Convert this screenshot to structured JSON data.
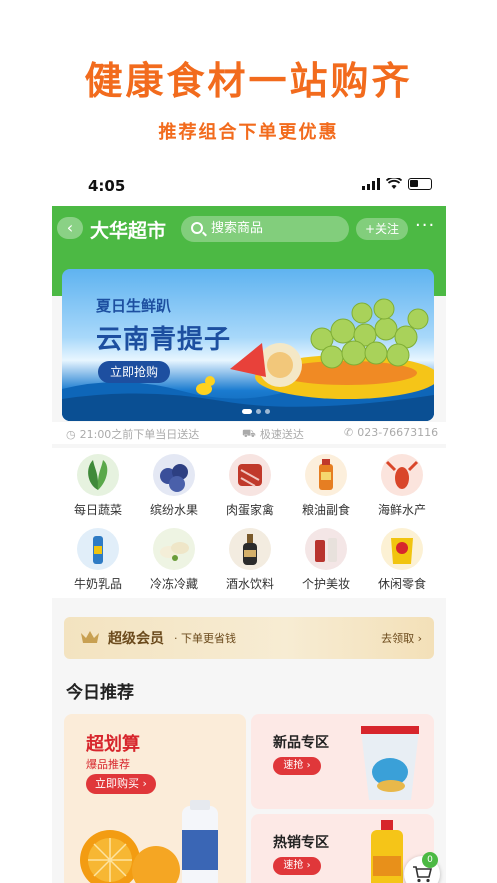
{
  "promo": {
    "headline": "健康食材一站购齐",
    "subline": "推荐组合下单更优惠"
  },
  "status_bar": {
    "time": "4:05"
  },
  "header": {
    "back_icon": "chevron-left-icon",
    "store_name": "大华超市",
    "search_placeholder": "搜索商品",
    "follow_label": "+关注",
    "more_label": "···",
    "accent_color": "#4cb944"
  },
  "banner": {
    "kicker": "夏日生鲜趴",
    "title": "云南青提子",
    "button_label": "立即抢购"
  },
  "info_strip": {
    "hours": "21:00之前下单当日送达",
    "delivery": "极速送达",
    "phone": "023-76673116"
  },
  "categories": [
    {
      "label": "每日蔬菜",
      "icon": "vegetable-icon",
      "color": "#3f8a3a"
    },
    {
      "label": "缤纷水果",
      "icon": "blueberry-icon",
      "color": "#3a4f9a"
    },
    {
      "label": "肉蛋家禽",
      "icon": "meat-icon",
      "color": "#c0392b"
    },
    {
      "label": "粮油副食",
      "icon": "oil-icon",
      "color": "#e67e22"
    },
    {
      "label": "海鲜水产",
      "icon": "crayfish-icon",
      "color": "#d9462a"
    },
    {
      "label": "牛奶乳品",
      "icon": "milk-icon",
      "color": "#2e7bc4"
    },
    {
      "label": "冷冻冷藏",
      "icon": "dumpling-icon",
      "color": "#6a9c3a"
    },
    {
      "label": "酒水饮料",
      "icon": "wine-icon",
      "color": "#7a5a2a"
    },
    {
      "label": "个护美妆",
      "icon": "cosmetics-icon",
      "color": "#b8332e"
    },
    {
      "label": "休闲零食",
      "icon": "snack-icon",
      "color": "#e0a020"
    }
  ],
  "vip": {
    "title": "超级会员",
    "subtitle": "· 下单更省钱",
    "action": "去领取 ›"
  },
  "recommend": {
    "section_title": "今日推荐",
    "big_card": {
      "title": "超划算",
      "subtitle": "爆品推荐",
      "button": "立即购买 ›"
    },
    "small_cards": [
      {
        "title": "新品专区",
        "button": "速抢 ›"
      },
      {
        "title": "热销专区",
        "button": "速抢 ›"
      }
    ]
  },
  "cart": {
    "badge": "0"
  }
}
